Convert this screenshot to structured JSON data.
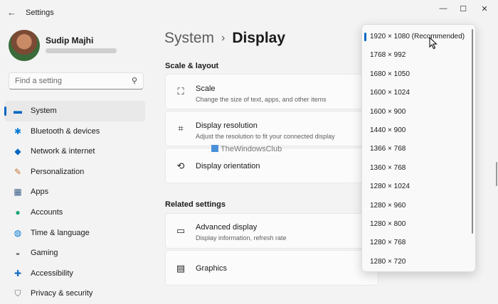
{
  "app": {
    "title": "Settings"
  },
  "user": {
    "name": "Sudip Majhi"
  },
  "search": {
    "placeholder": "Find a setting"
  },
  "nav": [
    {
      "label": "System",
      "icon": "monitor-icon",
      "glyph": "▬",
      "color": "#0067c0",
      "selected": true
    },
    {
      "label": "Bluetooth & devices",
      "icon": "bluetooth-icon",
      "glyph": "✱",
      "color": "#0078d4"
    },
    {
      "label": "Network & internet",
      "icon": "wifi-icon",
      "glyph": "◆",
      "color": "#0067c0"
    },
    {
      "label": "Personalization",
      "icon": "brush-icon",
      "glyph": "✎",
      "color": "#c8722c"
    },
    {
      "label": "Apps",
      "icon": "apps-icon",
      "glyph": "▦",
      "color": "#3b5f88"
    },
    {
      "label": "Accounts",
      "icon": "person-icon",
      "glyph": "●",
      "color": "#1aa37a"
    },
    {
      "label": "Time & language",
      "icon": "globe-clock-icon",
      "glyph": "◍",
      "color": "#0078d4"
    },
    {
      "label": "Gaming",
      "icon": "gamepad-icon",
      "glyph": "◒",
      "color": "#6b6b6b"
    },
    {
      "label": "Accessibility",
      "icon": "accessibility-icon",
      "glyph": "✚",
      "color": "#1a6dc2"
    },
    {
      "label": "Privacy & security",
      "icon": "shield-icon",
      "glyph": "⛉",
      "color": "#6b6b6b"
    }
  ],
  "main": {
    "breadcrumb_parent": "System",
    "breadcrumb_sep": "›",
    "breadcrumb_current": "Display",
    "section_scale": "Scale & layout",
    "cards_scale": [
      {
        "title": "Scale",
        "subtitle": "Change the size of text, apps, and other items",
        "icon": "scale-icon",
        "glyph": "⛶"
      },
      {
        "title": "Display resolution",
        "subtitle": "Adjust the resolution to fit your connected display",
        "icon": "resolution-icon",
        "glyph": "⌗"
      },
      {
        "title": "Display orientation",
        "subtitle": "",
        "icon": "orientation-icon",
        "glyph": "⟲"
      }
    ],
    "section_related": "Related settings",
    "cards_related": [
      {
        "title": "Advanced display",
        "subtitle": "Display information, refresh rate",
        "icon": "monitor-icon",
        "glyph": "▭"
      },
      {
        "title": "Graphics",
        "subtitle": "",
        "icon": "graphics-icon",
        "glyph": "▤"
      }
    ]
  },
  "watermark": "TheWindowsClub",
  "dropdown": {
    "options": [
      "1920 × 1080 (Recommended)",
      "1768 × 992",
      "1680 × 1050",
      "1600 × 1024",
      "1600 × 900",
      "1440 × 900",
      "1366 × 768",
      "1360 × 768",
      "1280 × 1024",
      "1280 × 960",
      "1280 × 800",
      "1280 × 768",
      "1280 × 720"
    ],
    "selected_index": 0
  },
  "colors": {
    "accent": "#0067c0",
    "background": "#f3f3f3",
    "card": "#fbfbfb"
  }
}
